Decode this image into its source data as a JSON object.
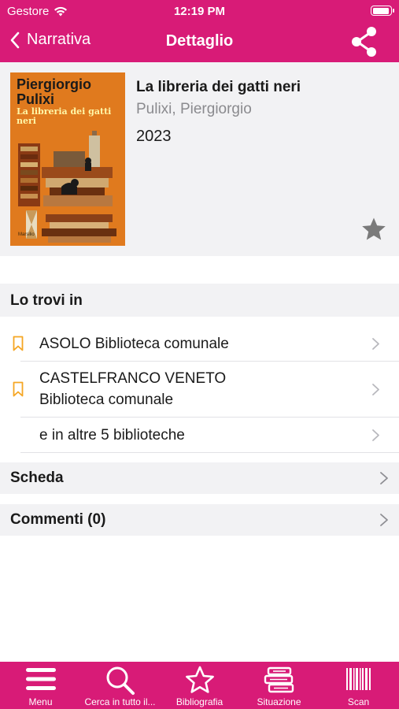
{
  "status_bar": {
    "carrier": "Gestore",
    "time": "12:19 PM"
  },
  "nav": {
    "back_label": "Narrativa",
    "title": "Dettaglio"
  },
  "book": {
    "cover": {
      "author_text": "Piergiorgio Pulixi",
      "title_text": "La libreria dei gatti neri",
      "publisher_text": "Marsilio"
    },
    "title": "La libreria dei gatti neri",
    "author": "Pulixi, Piergiorgio",
    "year": "2023"
  },
  "availability": {
    "header": "Lo trovi in",
    "libraries": [
      {
        "line1": "ASOLO Biblioteca comunale",
        "line2": ""
      },
      {
        "line1": "CASTELFRANCO VENETO",
        "line2": "Biblioteca comunale"
      }
    ],
    "more": "e in altre 5 biblioteche"
  },
  "sections": {
    "scheda": "Scheda",
    "commenti": "Commenti (0)"
  },
  "tabbar": {
    "items": [
      {
        "label": "Menu",
        "icon": "hamburger-icon"
      },
      {
        "label": "Cerca in tutto il...",
        "icon": "search-icon"
      },
      {
        "label": "Bibliografia",
        "icon": "star-icon"
      },
      {
        "label": "Situazione",
        "icon": "books-stack-icon"
      },
      {
        "label": "Scan",
        "icon": "barcode-icon"
      }
    ]
  },
  "colors": {
    "brand": "#d81b77",
    "bookmark": "#f5a623",
    "star": "#7a7a7a",
    "chevron": "#b8b8bd"
  }
}
